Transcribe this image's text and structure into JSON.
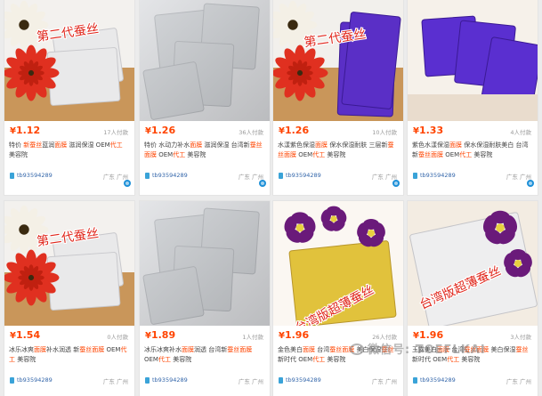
{
  "products": [
    {
      "price": "1.12",
      "sold": "17人付款",
      "title_parts": [
        [
          "特价 ",
          0
        ],
        [
          "新蚕丝",
          1
        ],
        [
          "蓝润",
          0
        ],
        [
          "面膜",
          1
        ],
        [
          " 滋润保湿 OEM",
          0
        ],
        [
          "代工",
          1
        ],
        [
          " 美容院",
          0
        ]
      ],
      "shop": "tb93594289",
      "location": "广东 广州",
      "image": "silk-mask-flower",
      "overlay_text": "第二代蚕丝"
    },
    {
      "price": "1.26",
      "sold": "36人付款",
      "title_parts": [
        [
          "特价 水动力补水",
          0
        ],
        [
          "面膜",
          1
        ],
        [
          " 滋润保湿 台湾新",
          0
        ],
        [
          "蚕丝",
          1
        ],
        [
          "面膜",
          1
        ],
        [
          " OEM",
          0
        ],
        [
          "代工",
          1
        ],
        [
          " 美容院",
          0
        ]
      ],
      "shop": "tb93594289",
      "location": "广东 广州",
      "image": "silver-foil-packs",
      "overlay_text": ""
    },
    {
      "price": "1.26",
      "sold": "10人付款",
      "title_parts": [
        [
          "水漾紫色保湿",
          0
        ],
        [
          "面膜",
          1
        ],
        [
          " 保水保湿耐肤 三层新",
          0
        ],
        [
          "蚕丝",
          1
        ],
        [
          "面膜",
          1
        ],
        [
          " OEM",
          0
        ],
        [
          "代工",
          1
        ],
        [
          " 美容院",
          0
        ]
      ],
      "shop": "tb93594289",
      "location": "广东 广州",
      "image": "purple-packs-flower",
      "overlay_text": "第二代蚕丝"
    },
    {
      "price": "1.33",
      "sold": "4人付款",
      "title_parts": [
        [
          "紫色水漾保湿",
          0
        ],
        [
          "面膜",
          1
        ],
        [
          " 保水保湿耐肤美白 台湾新",
          0
        ],
        [
          "蚕丝",
          1
        ],
        [
          "面膜",
          1
        ],
        [
          " OEM",
          0
        ],
        [
          "代工",
          1
        ],
        [
          " 美容院",
          0
        ]
      ],
      "shop": "tb93594289",
      "location": "广东 广州",
      "image": "purple-packs",
      "overlay_text": ""
    },
    {
      "price": "1.54",
      "sold": "0人付款",
      "title_parts": [
        [
          "冰乐冰爽",
          0
        ],
        [
          "面膜",
          1
        ],
        [
          "补水润透 新",
          0
        ],
        [
          "蚕丝",
          1
        ],
        [
          "面膜",
          1
        ],
        [
          " OEM",
          0
        ],
        [
          "代工",
          1
        ],
        [
          " 美容院",
          0
        ]
      ],
      "shop": "tb93594289",
      "location": "广东 广州",
      "image": "silk-mask-flower",
      "overlay_text": "第二代蚕丝"
    },
    {
      "price": "1.89",
      "sold": "1人付款",
      "title_parts": [
        [
          "冰乐冰爽补水",
          0
        ],
        [
          "面膜",
          1
        ],
        [
          "润透 台湾新",
          0
        ],
        [
          "蚕丝",
          1
        ],
        [
          "面膜",
          1
        ],
        [
          " OEM",
          0
        ],
        [
          "代工",
          1
        ],
        [
          " 美容院",
          0
        ]
      ],
      "shop": "tb93594289",
      "location": "广东 广州",
      "image": "silver-foil-packs",
      "overlay_text": ""
    },
    {
      "price": "1.96",
      "sold": "26人付款",
      "title_parts": [
        [
          "金色美白",
          0
        ],
        [
          "面膜",
          1
        ],
        [
          " 台湾",
          0
        ],
        [
          "蚕丝",
          1
        ],
        [
          "面膜",
          1
        ],
        [
          " 美白保湿",
          0
        ],
        [
          "蚕丝",
          1
        ],
        [
          " 新时代 OEM",
          0
        ],
        [
          "代工",
          1
        ],
        [
          " 美容院",
          0
        ]
      ],
      "shop": "tb93594289",
      "location": "广东 广州",
      "image": "gold-pack-orchid",
      "overlay_text": "台湾版超薄蚕丝"
    },
    {
      "price": "1.96",
      "sold": "3人付款",
      "title_parts": [
        [
          "玉露美白",
          0
        ],
        [
          "面膜",
          1
        ],
        [
          " 台湾",
          0
        ],
        [
          "蚕丝",
          1
        ],
        [
          "面膜",
          1
        ],
        [
          " 美白保湿",
          0
        ],
        [
          "蚕丝",
          1
        ],
        [
          " 新时代 OEM",
          0
        ],
        [
          "代工",
          1
        ],
        [
          " 美容院",
          0
        ]
      ],
      "shop": "tb93594289",
      "location": "广东 广州",
      "image": "white-pack-orchid",
      "overlay_text": "台湾版超薄蚕丝"
    }
  ],
  "watermark": "微信号: TOEFLKAI",
  "colors": {
    "price": "#ff4400",
    "highlight": "#ff4400",
    "shop": "#3366aa",
    "muted": "#999999"
  }
}
